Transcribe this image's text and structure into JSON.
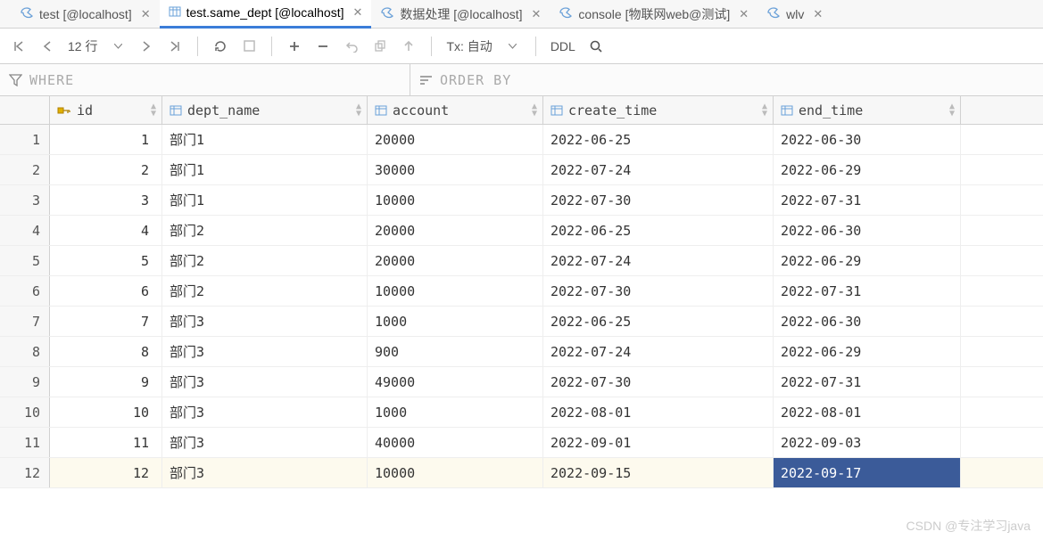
{
  "tabs": [
    {
      "label": "test [@localhost]",
      "icon": "sql",
      "active": false
    },
    {
      "label": "test.same_dept [@localhost]",
      "icon": "table",
      "active": true
    },
    {
      "label": "数据处理 [@localhost]",
      "icon": "sql",
      "active": false
    },
    {
      "label": "console [物联网web@测试]",
      "icon": "sql",
      "active": false
    },
    {
      "label": "wlv",
      "icon": "sql",
      "active": false
    }
  ],
  "toolbar": {
    "row_count_label": "12 行",
    "tx_label": "Tx: 自动",
    "ddl_label": "DDL"
  },
  "filters": {
    "where_label": "WHERE",
    "order_by_label": "ORDER BY"
  },
  "columns": [
    {
      "key": "id",
      "label": "id",
      "icon": "pk"
    },
    {
      "key": "dept_name",
      "label": "dept_name",
      "icon": "col"
    },
    {
      "key": "account",
      "label": "account",
      "icon": "col"
    },
    {
      "key": "create_time",
      "label": "create_time",
      "icon": "col"
    },
    {
      "key": "end_time",
      "label": "end_time",
      "icon": "col"
    }
  ],
  "rows": [
    {
      "rownum": "1",
      "id": "1",
      "dept_name": "部门1",
      "account": "20000",
      "create_time": "2022-06-25",
      "end_time": "2022-06-30"
    },
    {
      "rownum": "2",
      "id": "2",
      "dept_name": "部门1",
      "account": "30000",
      "create_time": "2022-07-24",
      "end_time": "2022-06-29"
    },
    {
      "rownum": "3",
      "id": "3",
      "dept_name": "部门1",
      "account": "10000",
      "create_time": "2022-07-30",
      "end_time": "2022-07-31"
    },
    {
      "rownum": "4",
      "id": "4",
      "dept_name": "部门2",
      "account": "20000",
      "create_time": "2022-06-25",
      "end_time": "2022-06-30"
    },
    {
      "rownum": "5",
      "id": "5",
      "dept_name": "部门2",
      "account": "20000",
      "create_time": "2022-07-24",
      "end_time": "2022-06-29"
    },
    {
      "rownum": "6",
      "id": "6",
      "dept_name": "部门2",
      "account": "10000",
      "create_time": "2022-07-30",
      "end_time": "2022-07-31"
    },
    {
      "rownum": "7",
      "id": "7",
      "dept_name": "部门3",
      "account": "1000",
      "create_time": "2022-06-25",
      "end_time": "2022-06-30"
    },
    {
      "rownum": "8",
      "id": "8",
      "dept_name": "部门3",
      "account": "900",
      "create_time": "2022-07-24",
      "end_time": "2022-06-29"
    },
    {
      "rownum": "9",
      "id": "9",
      "dept_name": "部门3",
      "account": "49000",
      "create_time": "2022-07-30",
      "end_time": "2022-07-31"
    },
    {
      "rownum": "10",
      "id": "10",
      "dept_name": "部门3",
      "account": "1000",
      "create_time": "2022-08-01",
      "end_time": "2022-08-01"
    },
    {
      "rownum": "11",
      "id": "11",
      "dept_name": "部门3",
      "account": "40000",
      "create_time": "2022-09-01",
      "end_time": "2022-09-03"
    },
    {
      "rownum": "12",
      "id": "12",
      "dept_name": "部门3",
      "account": "10000",
      "create_time": "2022-09-15",
      "end_time": "2022-09-17"
    }
  ],
  "selected": {
    "row": 11,
    "col": "end_time"
  },
  "watermark": "CSDN @专注学习java"
}
